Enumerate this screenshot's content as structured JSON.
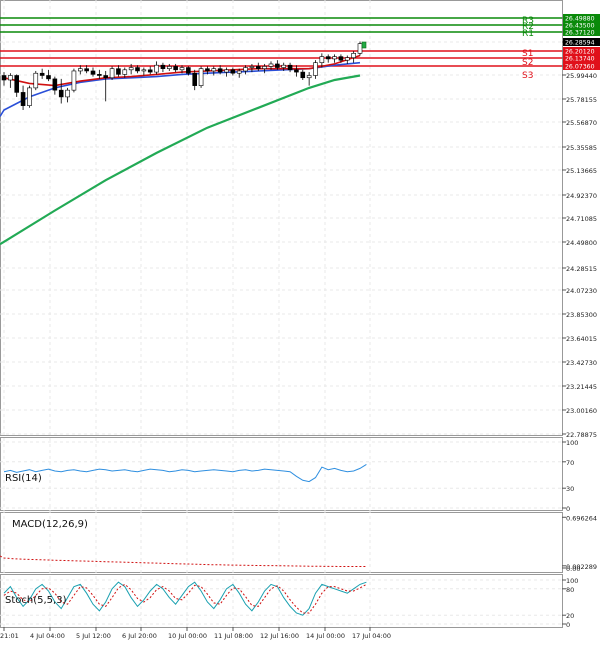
{
  "chart_data": {
    "type": "candlestick",
    "price_axis": {
      "ticks": [
        "26.49880",
        "26.43500",
        "26.37120",
        "26.28594",
        "26.20120",
        "26.13740",
        "26.07360",
        "25.99440",
        "25.78155",
        "25.56870",
        "25.35585",
        "25.13665",
        "24.92370",
        "24.71085",
        "24.49800",
        "24.28515",
        "24.07230",
        "23.85300",
        "23.64015",
        "23.42730",
        "23.21445",
        "23.00160",
        "22.78875"
      ],
      "ylim": [
        22.78875,
        26.57
      ]
    },
    "pivot_levels": [
      {
        "label": "R3",
        "value": 26.4988,
        "color": "#0a8a0a",
        "badge": "26.49880"
      },
      {
        "label": "R2",
        "value": 26.435,
        "color": "#0a8a0a",
        "badge": "26.43500"
      },
      {
        "label": "R1",
        "value": 26.3712,
        "color": "#0a8a0a",
        "badge": "26.37120"
      },
      {
        "label": "S1",
        "value": 26.2012,
        "color": "#e0101a",
        "badge": "26.20120"
      },
      {
        "label": "S2",
        "value": 26.1374,
        "color": "#e0101a",
        "badge": "26.13740"
      },
      {
        "label": "S3",
        "value": 26.0736,
        "color": "#e0101a",
        "badge": "26.07360"
      }
    ],
    "current_price": {
      "value": 26.28594,
      "badge": "26.28594"
    },
    "x_ticks": [
      "21:01",
      "4 Jul 04:00",
      "5 Jul 12:00",
      "6 Jul 20:00",
      "10 Jul 00:00",
      "11 Jul 08:00",
      "12 Jul 16:00",
      "14 Jul 00:00",
      "17 Jul 04:00"
    ],
    "candles": [
      {
        "o": 25.99,
        "h": 26.02,
        "l": 25.9,
        "c": 25.95
      },
      {
        "o": 25.95,
        "h": 26.01,
        "l": 25.88,
        "c": 25.99
      },
      {
        "o": 25.99,
        "h": 26.0,
        "l": 25.8,
        "c": 25.84
      },
      {
        "o": 25.84,
        "h": 25.9,
        "l": 25.68,
        "c": 25.72
      },
      {
        "o": 25.72,
        "h": 25.9,
        "l": 25.7,
        "c": 25.88
      },
      {
        "o": 25.88,
        "h": 26.03,
        "l": 25.86,
        "c": 26.01
      },
      {
        "o": 26.01,
        "h": 26.05,
        "l": 25.96,
        "c": 25.99
      },
      {
        "o": 25.99,
        "h": 26.04,
        "l": 25.94,
        "c": 25.96
      },
      {
        "o": 25.96,
        "h": 25.98,
        "l": 25.82,
        "c": 25.86
      },
      {
        "o": 25.86,
        "h": 25.96,
        "l": 25.74,
        "c": 25.8
      },
      {
        "o": 25.8,
        "h": 25.88,
        "l": 25.75,
        "c": 25.86
      },
      {
        "o": 25.86,
        "h": 26.05,
        "l": 25.84,
        "c": 26.03
      },
      {
        "o": 26.03,
        "h": 26.08,
        "l": 26.0,
        "c": 26.05
      },
      {
        "o": 26.05,
        "h": 26.08,
        "l": 26.01,
        "c": 26.03
      },
      {
        "o": 26.03,
        "h": 26.06,
        "l": 25.98,
        "c": 26.0
      },
      {
        "o": 26.0,
        "h": 26.04,
        "l": 25.96,
        "c": 25.99
      },
      {
        "o": 25.99,
        "h": 26.03,
        "l": 25.76,
        "c": 25.97
      },
      {
        "o": 25.97,
        "h": 26.07,
        "l": 25.95,
        "c": 26.05
      },
      {
        "o": 26.05,
        "h": 26.08,
        "l": 25.98,
        "c": 26.0
      },
      {
        "o": 26.0,
        "h": 26.06,
        "l": 25.97,
        "c": 26.04
      },
      {
        "o": 26.04,
        "h": 26.09,
        "l": 26.0,
        "c": 26.06
      },
      {
        "o": 26.06,
        "h": 26.08,
        "l": 26.01,
        "c": 26.03
      },
      {
        "o": 26.03,
        "h": 26.06,
        "l": 25.99,
        "c": 26.04
      },
      {
        "o": 26.04,
        "h": 26.07,
        "l": 26.0,
        "c": 26.02
      },
      {
        "o": 26.02,
        "h": 26.11,
        "l": 26.0,
        "c": 26.08
      },
      {
        "o": 26.08,
        "h": 26.1,
        "l": 26.02,
        "c": 26.05
      },
      {
        "o": 26.05,
        "h": 26.09,
        "l": 26.03,
        "c": 26.07
      },
      {
        "o": 26.07,
        "h": 26.09,
        "l": 26.02,
        "c": 26.04
      },
      {
        "o": 26.04,
        "h": 26.08,
        "l": 26.01,
        "c": 26.06
      },
      {
        "o": 26.06,
        "h": 26.07,
        "l": 25.99,
        "c": 26.01
      },
      {
        "o": 26.01,
        "h": 26.04,
        "l": 25.86,
        "c": 25.9
      },
      {
        "o": 25.9,
        "h": 26.07,
        "l": 25.88,
        "c": 26.05
      },
      {
        "o": 26.05,
        "h": 26.07,
        "l": 26.0,
        "c": 26.03
      },
      {
        "o": 26.03,
        "h": 26.07,
        "l": 25.99,
        "c": 26.05
      },
      {
        "o": 26.05,
        "h": 26.08,
        "l": 26.0,
        "c": 26.02
      },
      {
        "o": 26.02,
        "h": 26.06,
        "l": 25.98,
        "c": 26.04
      },
      {
        "o": 26.04,
        "h": 26.06,
        "l": 25.99,
        "c": 26.01
      },
      {
        "o": 26.01,
        "h": 26.05,
        "l": 25.97,
        "c": 26.03
      },
      {
        "o": 26.03,
        "h": 26.08,
        "l": 26.0,
        "c": 26.06
      },
      {
        "o": 26.06,
        "h": 26.09,
        "l": 26.02,
        "c": 26.07
      },
      {
        "o": 26.07,
        "h": 26.1,
        "l": 26.03,
        "c": 26.05
      },
      {
        "o": 26.05,
        "h": 26.09,
        "l": 26.01,
        "c": 26.07
      },
      {
        "o": 26.07,
        "h": 26.11,
        "l": 26.04,
        "c": 26.09
      },
      {
        "o": 26.09,
        "h": 26.12,
        "l": 26.04,
        "c": 26.06
      },
      {
        "o": 26.06,
        "h": 26.1,
        "l": 26.03,
        "c": 26.08
      },
      {
        "o": 26.08,
        "h": 26.1,
        "l": 26.02,
        "c": 26.04
      },
      {
        "o": 26.04,
        "h": 26.08,
        "l": 25.98,
        "c": 26.02
      },
      {
        "o": 26.02,
        "h": 26.04,
        "l": 25.95,
        "c": 25.97
      },
      {
        "o": 25.97,
        "h": 26.02,
        "l": 25.9,
        "c": 25.99
      },
      {
        "o": 25.99,
        "h": 26.12,
        "l": 25.96,
        "c": 26.1
      },
      {
        "o": 26.1,
        "h": 26.18,
        "l": 26.06,
        "c": 26.15
      },
      {
        "o": 26.15,
        "h": 26.17,
        "l": 26.1,
        "c": 26.13
      },
      {
        "o": 26.13,
        "h": 26.17,
        "l": 26.1,
        "c": 26.15
      },
      {
        "o": 26.15,
        "h": 26.17,
        "l": 26.1,
        "c": 26.12
      },
      {
        "o": 26.12,
        "h": 26.16,
        "l": 26.09,
        "c": 26.14
      },
      {
        "o": 26.14,
        "h": 26.2,
        "l": 26.1,
        "c": 26.18
      },
      {
        "o": 26.18,
        "h": 26.29,
        "l": 26.16,
        "c": 26.27
      }
    ],
    "ma_fast": [
      [
        0,
        25.97
      ],
      [
        4,
        25.92
      ],
      [
        8,
        25.9
      ],
      [
        12,
        25.94
      ],
      [
        16,
        25.97
      ],
      [
        20,
        25.98
      ],
      [
        24,
        26.0
      ],
      [
        28,
        26.02
      ],
      [
        32,
        26.03
      ],
      [
        36,
        26.04
      ],
      [
        40,
        26.05
      ],
      [
        44,
        26.05
      ],
      [
        48,
        26.05
      ],
      [
        52,
        26.09
      ],
      [
        56,
        26.16
      ]
    ],
    "ma_slow": [
      [
        0,
        25.68
      ],
      [
        4,
        25.8
      ],
      [
        8,
        25.88
      ],
      [
        12,
        25.93
      ],
      [
        16,
        25.96
      ],
      [
        20,
        25.97
      ],
      [
        24,
        25.98
      ],
      [
        28,
        26.0
      ],
      [
        32,
        26.01
      ],
      [
        36,
        26.02
      ],
      [
        40,
        26.03
      ],
      [
        44,
        26.04
      ],
      [
        48,
        26.05
      ],
      [
        52,
        26.08
      ],
      [
        56,
        26.1
      ]
    ],
    "ma_long": [
      [
        0,
        24.5
      ],
      [
        8,
        24.78
      ],
      [
        16,
        25.05
      ],
      [
        24,
        25.3
      ],
      [
        32,
        25.52
      ],
      [
        40,
        25.7
      ],
      [
        48,
        25.88
      ],
      [
        52,
        25.95
      ],
      [
        56,
        25.99
      ]
    ],
    "rsi": {
      "label": "RSI(14)",
      "levels": [
        "100",
        "70",
        "30",
        "0"
      ],
      "values": [
        55,
        57,
        54,
        56,
        58,
        55,
        57,
        59,
        56,
        55,
        57,
        58,
        56,
        55,
        57,
        59,
        58,
        56,
        57,
        58,
        56,
        55,
        57,
        59,
        58,
        57,
        55,
        56,
        58,
        57,
        55,
        56,
        57,
        58,
        57,
        56,
        55,
        57,
        58,
        56,
        57,
        59,
        58,
        57,
        56,
        55,
        48,
        42,
        40,
        46,
        62,
        58,
        60,
        57,
        55,
        56,
        60,
        66
      ]
    },
    "macd": {
      "label": "MACD(12,26,9)",
      "levels": [
        "0.696264",
        "0.002289",
        "0.00"
      ],
      "signal_values": [
        0.1,
        0.095,
        0.09,
        0.087,
        0.085,
        0.082,
        0.08,
        0.078,
        0.075,
        0.073,
        0.071,
        0.069,
        0.067,
        0.065,
        0.063,
        0.061,
        0.059,
        0.057,
        0.055,
        0.053,
        0.051,
        0.049,
        0.047,
        0.045,
        0.043,
        0.041,
        0.039,
        0.037,
        0.035,
        0.033,
        0.031,
        0.029,
        0.027,
        0.025,
        0.024,
        0.022,
        0.021,
        0.02,
        0.019,
        0.018,
        0.017,
        0.016,
        0.015,
        0.014,
        0.013,
        0.012,
        0.011,
        0.01,
        0.009,
        0.008,
        0.008,
        0.007,
        0.007,
        0.006,
        0.006,
        0.005,
        0.005,
        0.005
      ]
    },
    "stoch": {
      "label": "Stoch(5,5,3)",
      "levels": [
        "100",
        "80",
        "20",
        "0"
      ],
      "k": [
        70,
        85,
        60,
        40,
        55,
        80,
        90,
        75,
        50,
        35,
        60,
        85,
        90,
        70,
        45,
        30,
        50,
        80,
        95,
        85,
        60,
        40,
        55,
        75,
        90,
        80,
        60,
        45,
        65,
        85,
        95,
        75,
        50,
        35,
        55,
        80,
        90,
        70,
        45,
        30,
        50,
        75,
        90,
        85,
        60,
        40,
        25,
        20,
        35,
        70,
        90,
        85,
        80,
        75,
        70,
        80,
        90,
        95
      ],
      "d": [
        65,
        75,
        70,
        55,
        50,
        65,
        80,
        82,
        70,
        50,
        45,
        65,
        85,
        82,
        65,
        45,
        40,
        60,
        82,
        90,
        78,
        58,
        50,
        60,
        78,
        85,
        75,
        58,
        55,
        70,
        88,
        85,
        68,
        48,
        45,
        65,
        82,
        80,
        62,
        42,
        40,
        60,
        80,
        87,
        75,
        55,
        38,
        25,
        25,
        45,
        70,
        85,
        85,
        80,
        75,
        75,
        82,
        90
      ]
    }
  }
}
